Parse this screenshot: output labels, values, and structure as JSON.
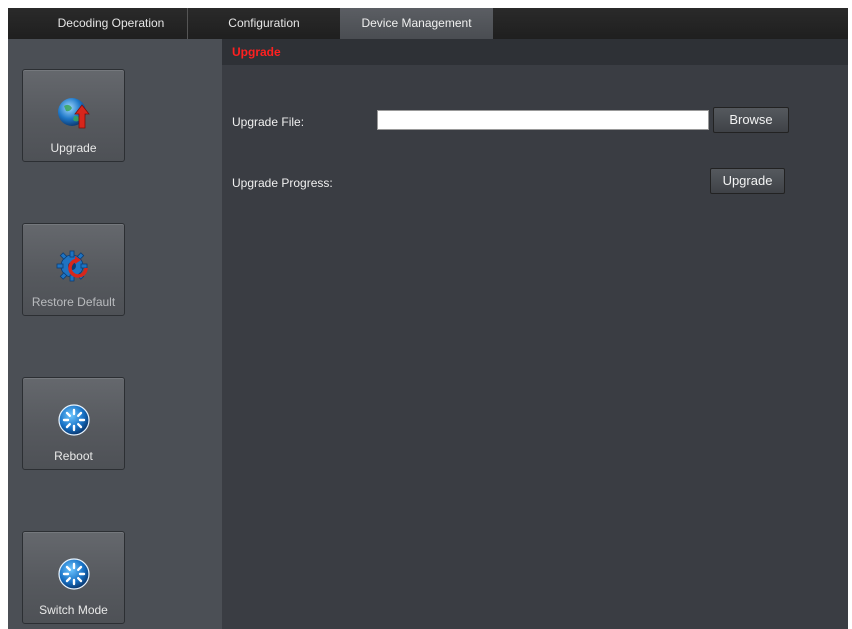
{
  "tabs": [
    {
      "label": "Decoding Operation",
      "active": false
    },
    {
      "label": "Configuration",
      "active": false
    },
    {
      "label": "Device Management",
      "active": true
    }
  ],
  "sidebar": {
    "items": [
      {
        "label": "Upgrade",
        "icon": "globe-upload-icon"
      },
      {
        "label": "Restore Default",
        "icon": "gear-restore-icon"
      },
      {
        "label": "Reboot",
        "icon": "reboot-icon"
      },
      {
        "label": "Switch Mode",
        "icon": "switch-mode-icon"
      }
    ]
  },
  "main": {
    "section_title": "Upgrade",
    "upgrade_file_label": "Upgrade File:",
    "upgrade_file_value": "",
    "browse_label": "Browse",
    "upgrade_progress_label": "Upgrade Progress:",
    "upgrade_button_label": "Upgrade"
  },
  "colors": {
    "section_title": "#ff2020",
    "background": "#3a3d43",
    "sidebar": "#4b4f55"
  }
}
